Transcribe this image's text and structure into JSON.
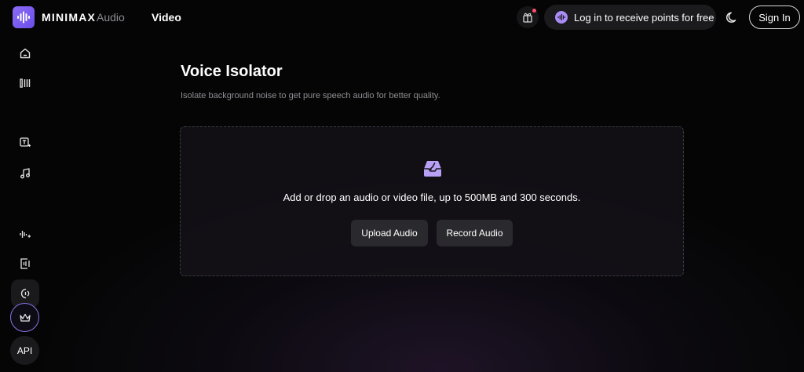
{
  "header": {
    "brand": "MINIMAX",
    "brand_sub": "Audio",
    "nav_video": "Video",
    "login_text": "Log in to receive points for free",
    "sign_in": "Sign In"
  },
  "sidebar": {
    "items": [
      {
        "icon": "home-icon"
      },
      {
        "icon": "library-icon"
      },
      {
        "icon": "text-to-speech-icon"
      },
      {
        "icon": "music-icon"
      },
      {
        "icon": "voice-clone-icon"
      },
      {
        "icon": "voice-design-icon"
      },
      {
        "icon": "voice-isolator-icon",
        "active": true
      }
    ],
    "api_label": "API"
  },
  "main": {
    "title": "Voice Isolator",
    "description": "Isolate background noise to get pure speech audio for better quality.",
    "drop_text": "Add or drop an audio or video file, up to 500MB and 300 seconds.",
    "upload_button": "Upload Audio",
    "record_button": "Record Audio"
  },
  "colors": {
    "accent": "#8b6cf6",
    "background": "#050505",
    "button": "#2a2a2e"
  }
}
